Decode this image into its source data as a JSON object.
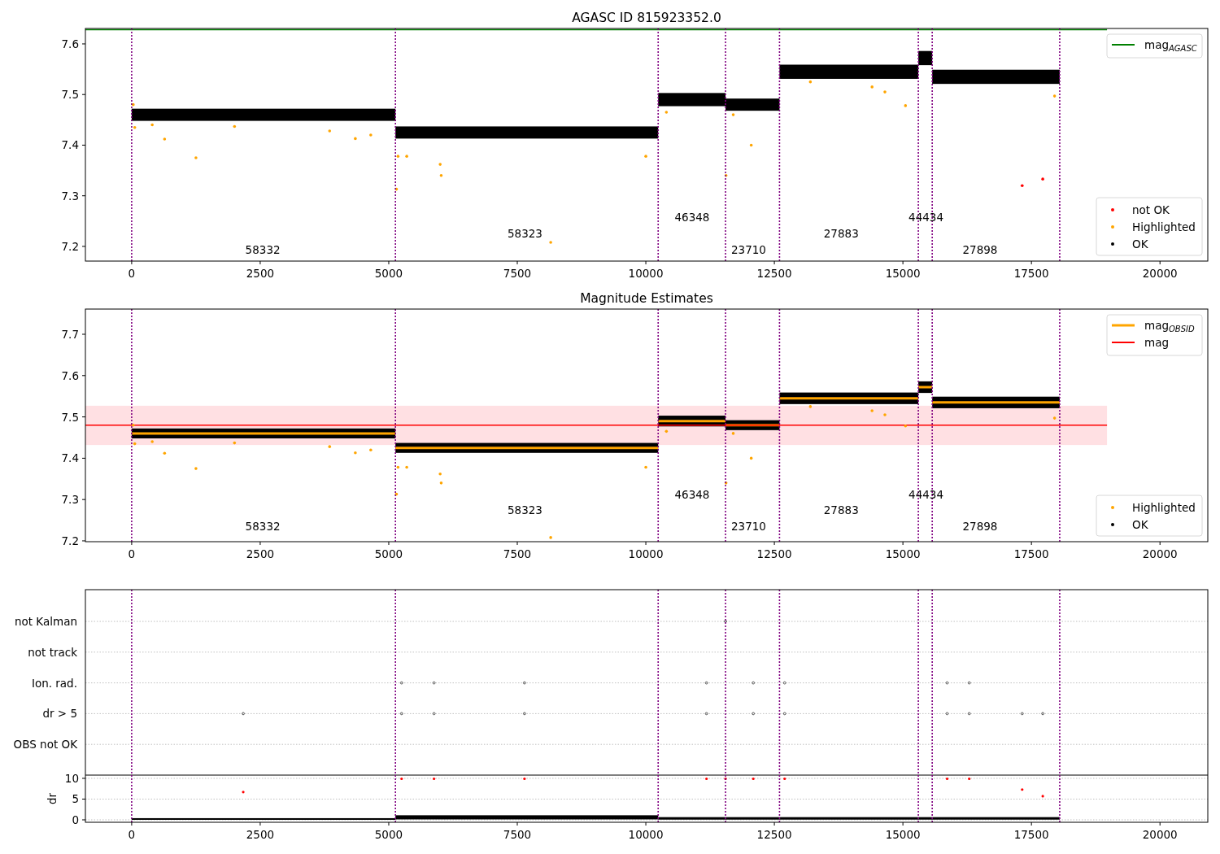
{
  "panels": [
    {
      "kind": "magnitude",
      "title": "AGASC ID 815923352.0",
      "x_tick_labels": [
        "0",
        "2500",
        "5000",
        "7500",
        "10000",
        "12500",
        "15000",
        "17500",
        "20000"
      ],
      "y_tick_labels": [
        "7.6",
        "7.5",
        "7.4",
        "7.3",
        "7.2"
      ],
      "obsid_labels": [
        "58332",
        "58323",
        "46348",
        "23710",
        "27883",
        "44434",
        "27898"
      ],
      "line_legend": [
        {
          "kind": "constant",
          "label": "mag",
          "sub": "AGASC",
          "color": "#008000"
        }
      ],
      "marker_legend": [
        {
          "label": "not OK",
          "color": "#ff0000"
        },
        {
          "label": "Highlighted",
          "color": "#ffa500"
        },
        {
          "label": "OK",
          "color": "#000000"
        }
      ]
    },
    {
      "kind": "magnitude",
      "title": "Magnitude Estimates",
      "x_tick_labels": [
        "0",
        "2500",
        "5000",
        "7500",
        "10000",
        "12500",
        "15000",
        "17500",
        "20000"
      ],
      "y_tick_labels": [
        "7.7",
        "7.6",
        "7.5",
        "7.4",
        "7.3",
        "7.2"
      ],
      "obsid_labels": [
        "58332",
        "58323",
        "46348",
        "23710",
        "27883",
        "44434",
        "27898"
      ],
      "line_legend": [
        {
          "kind": "segment_mean",
          "label": "mag",
          "sub": "OBSID",
          "color": "#ffa500"
        },
        {
          "kind": "constant",
          "label": "mag",
          "color": "#ff0000"
        }
      ],
      "marker_legend": [
        {
          "label": "Highlighted",
          "color": "#ffa500"
        },
        {
          "label": "OK",
          "color": "#000000"
        }
      ]
    },
    {
      "kind": "flags",
      "flag_rows": [
        "not Kalman",
        "not track",
        "Ion. rad.",
        "dr > 5",
        "OBS not OK"
      ],
      "ylabel": "dr",
      "y_tick_labels": [
        "10",
        "5",
        "0"
      ],
      "x_tick_labels": [
        "0",
        "2500",
        "5000",
        "7500",
        "10000",
        "12500",
        "15000",
        "17500",
        "20000"
      ]
    }
  ]
}
